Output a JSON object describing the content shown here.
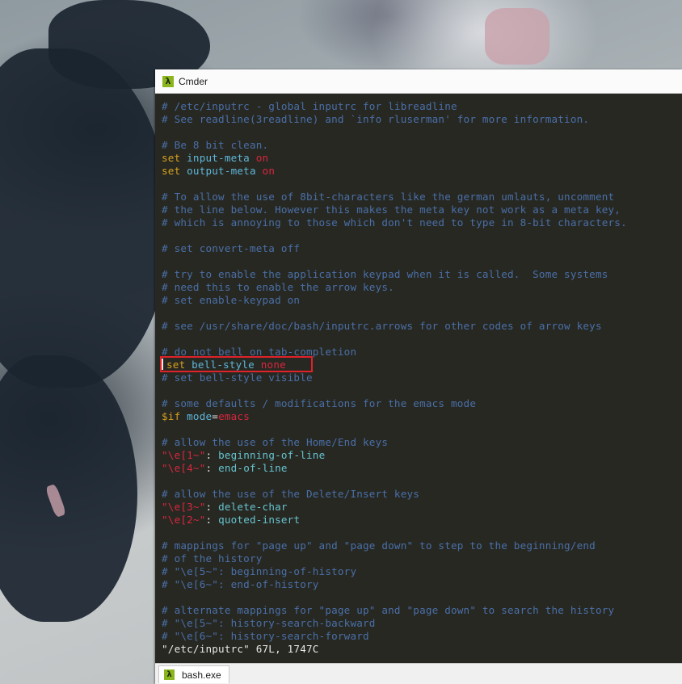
{
  "window": {
    "title": "Cmder",
    "app_icon_glyph": "λ"
  },
  "terminal": {
    "lines": [
      [
        {
          "t": "# /etc/inputrc - global inputrc for libreadline",
          "c": "comment"
        }
      ],
      [
        {
          "t": "# See readline(3readline) and `info rluserman' for more information.",
          "c": "comment"
        }
      ],
      [],
      [
        {
          "t": "# Be 8 bit clean.",
          "c": "comment"
        }
      ],
      [
        {
          "t": "set ",
          "c": "kw"
        },
        {
          "t": "input-meta ",
          "c": "id"
        },
        {
          "t": "on",
          "c": "on"
        }
      ],
      [
        {
          "t": "set ",
          "c": "kw"
        },
        {
          "t": "output-meta ",
          "c": "id"
        },
        {
          "t": "on",
          "c": "on"
        }
      ],
      [],
      [
        {
          "t": "# To allow the use of 8bit-characters like the german umlauts, uncomment",
          "c": "comment"
        }
      ],
      [
        {
          "t": "# the line below. However this makes the meta key not work as a meta key,",
          "c": "comment"
        }
      ],
      [
        {
          "t": "# which is annoying to those which don't need to type in 8-bit characters.",
          "c": "comment"
        }
      ],
      [],
      [
        {
          "t": "# set convert-meta off",
          "c": "comment"
        }
      ],
      [],
      [
        {
          "t": "# try to enable the application keypad when it is called.  Some systems",
          "c": "comment"
        }
      ],
      [
        {
          "t": "# need this to enable the arrow keys.",
          "c": "comment"
        }
      ],
      [
        {
          "t": "# set enable-keypad on",
          "c": "comment"
        }
      ],
      [],
      [
        {
          "t": "# see /usr/share/doc/bash/inputrc.arrows for other codes of arrow keys",
          "c": "comment"
        }
      ],
      [],
      [
        {
          "t": "# do not bell on tab-completion",
          "c": "comment"
        }
      ],
      [
        {
          "cursor": true
        },
        {
          "t": "set ",
          "c": "kw"
        },
        {
          "t": "bell-style ",
          "c": "id"
        },
        {
          "t": "none",
          "c": "on"
        }
      ],
      [
        {
          "t": "# set bell-style visible",
          "c": "comment"
        }
      ],
      [],
      [
        {
          "t": "# some defaults / modifications for the emacs mode",
          "c": "comment"
        }
      ],
      [
        {
          "t": "$if ",
          "c": "if"
        },
        {
          "t": "mode",
          "c": "id"
        },
        {
          "t": "=",
          "c": "op"
        },
        {
          "t": "emacs",
          "c": "on"
        }
      ],
      [],
      [
        {
          "t": "# allow the use of the Home/End keys",
          "c": "comment"
        }
      ],
      [
        {
          "t": "\"\\e[1~\"",
          "c": "str"
        },
        {
          "t": ": ",
          "c": "op"
        },
        {
          "t": "beginning-of-line",
          "c": "val"
        }
      ],
      [
        {
          "t": "\"\\e[4~\"",
          "c": "str"
        },
        {
          "t": ": ",
          "c": "op"
        },
        {
          "t": "end-of-line",
          "c": "val"
        }
      ],
      [],
      [
        {
          "t": "# allow the use of the Delete/Insert keys",
          "c": "comment"
        }
      ],
      [
        {
          "t": "\"\\e[3~\"",
          "c": "str"
        },
        {
          "t": ": ",
          "c": "op"
        },
        {
          "t": "delete-char",
          "c": "val"
        }
      ],
      [
        {
          "t": "\"\\e[2~\"",
          "c": "str"
        },
        {
          "t": ": ",
          "c": "op"
        },
        {
          "t": "quoted-insert",
          "c": "val"
        }
      ],
      [],
      [
        {
          "t": "# mappings for \"page up\" and \"page down\" to step to the beginning/end",
          "c": "comment"
        }
      ],
      [
        {
          "t": "# of the history",
          "c": "comment"
        }
      ],
      [
        {
          "t": "# \"\\e[5~\": beginning-of-history",
          "c": "comment"
        }
      ],
      [
        {
          "t": "# \"\\e[6~\": end-of-history",
          "c": "comment"
        }
      ],
      [],
      [
        {
          "t": "# alternate mappings for \"page up\" and \"page down\" to search the history",
          "c": "comment"
        }
      ],
      [
        {
          "t": "# \"\\e[5~\": history-search-backward",
          "c": "comment"
        }
      ],
      [
        {
          "t": "# \"\\e[6~\": history-search-forward",
          "c": "comment"
        }
      ],
      [
        {
          "t": "\"/etc/inputrc\" 67L, 1747C",
          "c": "status"
        }
      ]
    ]
  },
  "tabbar": {
    "tabs": [
      {
        "label": "bash.exe",
        "icon_glyph": "λ"
      }
    ]
  },
  "colors": {
    "terminal_bg": "#272822",
    "comment": "#4a6fa8",
    "keyword": "#d7a01f",
    "identifier": "#5fb6d9",
    "value_on": "#d9263f",
    "highlight_box": "#e0222a"
  }
}
